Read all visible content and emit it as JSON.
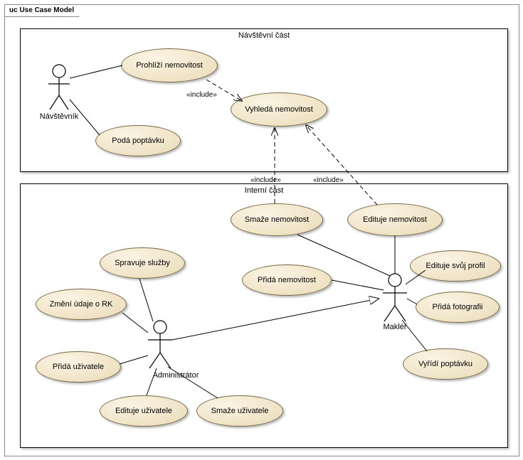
{
  "diagram": {
    "title": "uc Use Case Model",
    "systems": {
      "visitor": {
        "title": "Návštěvní část"
      },
      "internal": {
        "title": "Interní část"
      }
    },
    "actors": {
      "visitor": "Návštěvník",
      "admin": "Administrátor",
      "broker": "Makléř"
    },
    "usecases": {
      "browse": "Prohlíží nemovitost",
      "search": "Vyhledá nemovitost",
      "submit_demand": "Podá poptávku",
      "delete_prop": "Smaže nemovitost",
      "edit_prop": "Edituje nemovitost",
      "add_prop": "Přidá nemovitost",
      "edit_profile": "Edituje svůj profil",
      "add_photo": "Přidá fotografii",
      "handle_demand": "Vyřídí poptávku",
      "manage_services": "Spravuje služby",
      "change_rk": "Změní údaje o RK",
      "add_user": "Přidá uživatele",
      "edit_user": "Edituje uživatele",
      "delete_user": "Smaže uživatele"
    },
    "stereotypes": {
      "inc1": "«include»",
      "inc2": "«include»",
      "inc3": "«include»"
    }
  },
  "chart_data": {
    "type": "uml-use-case",
    "frame": "uc Use Case Model",
    "actors": [
      {
        "id": "visitor",
        "name": "Návštěvník",
        "system": "Návštěvní část"
      },
      {
        "id": "admin",
        "name": "Administrátor",
        "system": "Interní část"
      },
      {
        "id": "broker",
        "name": "Makléř",
        "system": "Interní část"
      }
    ],
    "systems": [
      {
        "id": "visitor_part",
        "name": "Návštěvní část"
      },
      {
        "id": "internal_part",
        "name": "Interní část"
      }
    ],
    "usecases": [
      {
        "id": "browse",
        "name": "Prohlíží nemovitost",
        "system": "Návštěvní část"
      },
      {
        "id": "search",
        "name": "Vyhledá nemovitost",
        "system": "Návštěvní část"
      },
      {
        "id": "submit_demand",
        "name": "Podá poptávku",
        "system": "Návštěvní část"
      },
      {
        "id": "delete_prop",
        "name": "Smaže nemovitost",
        "system": "Interní část"
      },
      {
        "id": "edit_prop",
        "name": "Edituje nemovitost",
        "system": "Interní část"
      },
      {
        "id": "add_prop",
        "name": "Přidá nemovitost",
        "system": "Interní část"
      },
      {
        "id": "edit_profile",
        "name": "Edituje svůj profil",
        "system": "Interní část"
      },
      {
        "id": "add_photo",
        "name": "Přidá fotografii",
        "system": "Interní část"
      },
      {
        "id": "handle_demand",
        "name": "Vyřídí poptávku",
        "system": "Interní část"
      },
      {
        "id": "manage_services",
        "name": "Spravuje služby",
        "system": "Interní část"
      },
      {
        "id": "change_rk",
        "name": "Změní údaje o RK",
        "system": "Interní část"
      },
      {
        "id": "add_user",
        "name": "Přidá uživatele",
        "system": "Interní část"
      },
      {
        "id": "edit_user",
        "name": "Edituje uživatele",
        "system": "Interní část"
      },
      {
        "id": "delete_user",
        "name": "Smaže uživatele",
        "system": "Interní část"
      }
    ],
    "associations": [
      {
        "from": "visitor",
        "to": "browse"
      },
      {
        "from": "visitor",
        "to": "submit_demand"
      },
      {
        "from": "broker",
        "to": "delete_prop"
      },
      {
        "from": "broker",
        "to": "edit_prop"
      },
      {
        "from": "broker",
        "to": "add_prop"
      },
      {
        "from": "broker",
        "to": "edit_profile"
      },
      {
        "from": "broker",
        "to": "add_photo"
      },
      {
        "from": "broker",
        "to": "handle_demand"
      },
      {
        "from": "admin",
        "to": "manage_services"
      },
      {
        "from": "admin",
        "to": "change_rk"
      },
      {
        "from": "admin",
        "to": "add_user"
      },
      {
        "from": "admin",
        "to": "edit_user"
      },
      {
        "from": "admin",
        "to": "delete_user"
      }
    ],
    "includes": [
      {
        "from": "browse",
        "to": "search"
      },
      {
        "from": "delete_prop",
        "to": "search"
      },
      {
        "from": "edit_prop",
        "to": "search"
      }
    ],
    "generalizations": [
      {
        "child": "admin",
        "parent": "broker"
      }
    ]
  }
}
